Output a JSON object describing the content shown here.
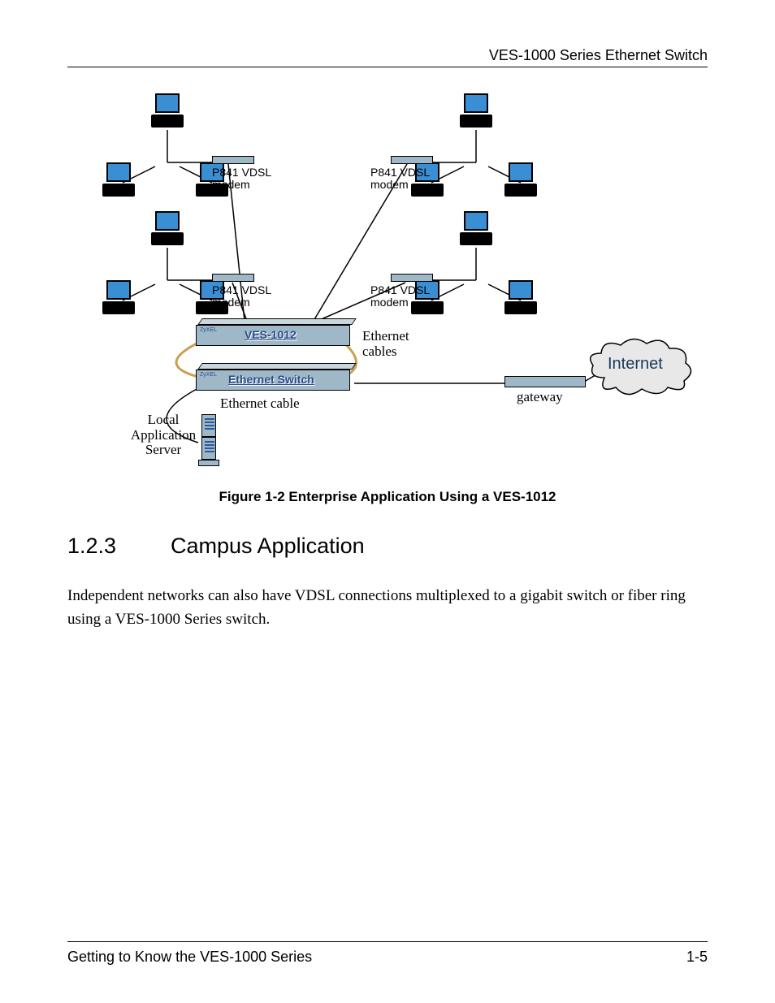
{
  "header": {
    "right": "VES-1000 Series Ethernet Switch"
  },
  "figure": {
    "caption": "Figure 1-2 Enterprise Application Using a VES-1012",
    "labels": {
      "modem_tl": "P841 VDSL\nmodem",
      "modem_tr": "P841 VDSL\nmodem",
      "modem_bl": "P841 VDSL\nmodem",
      "modem_br": "P841 VDSL\nmodem",
      "ves_switch": "VES-1012",
      "eth_switch": "Ethernet Switch",
      "eth_cables": "Ethernet\ncables",
      "eth_cable": "Ethernet cable",
      "gateway": "gateway",
      "internet": "Internet",
      "local_app_server": "Local\nApplication\nServer"
    }
  },
  "section": {
    "number": "1.2.3",
    "title": "Campus Application"
  },
  "body": {
    "p1": "Independent networks can also have VDSL connections multiplexed to a gigabit switch or fiber ring using a VES-1000 Series switch."
  },
  "footer": {
    "left": "Getting to Know the VES-1000 Series",
    "right": "1-5"
  }
}
